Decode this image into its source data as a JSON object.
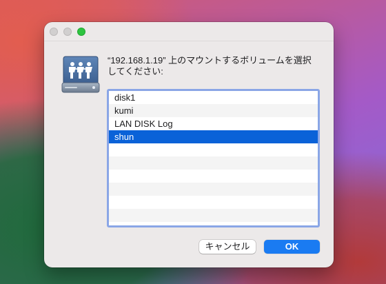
{
  "dialog": {
    "message": "“192.168.1.19” 上のマウントするボリュームを選択してください:",
    "volumes": [
      "disk1",
      "kumi",
      "LAN DISK Log",
      "shun"
    ],
    "selected_index": 3,
    "cancel_label": "キャンセル",
    "ok_label": "OK"
  },
  "icons": {
    "window_close": "close-icon",
    "window_minimize": "minimize-icon",
    "window_zoom": "zoom-icon",
    "server_volume": "shared-server-drive-icon"
  },
  "colors": {
    "selection": "#0a62d8",
    "accent_button": "#1a7bf2",
    "focus_ring": "#8aa6e6"
  }
}
